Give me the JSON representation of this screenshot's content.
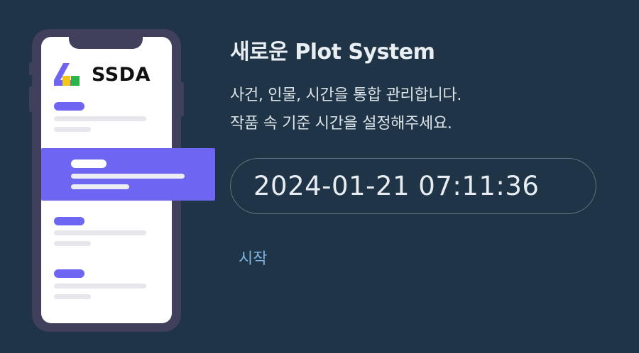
{
  "brand": {
    "logo_text": "SSDA",
    "logo_icon": "ssda-logo-icon",
    "logo_colors": [
      "#6e66f2",
      "#f5c518",
      "#2db34a"
    ]
  },
  "colors": {
    "background": "#1f3446",
    "phone_frame": "#40405c",
    "accent": "#6e66f2",
    "link": "#7fb3e0"
  },
  "info": {
    "title": "새로운 Plot System",
    "description_line1": "사건, 인물, 시간을 통합 관리합니다.",
    "description_line2": "작품 속 기준 시간을 설정해주세요."
  },
  "time_input": {
    "value": "2024-01-21 07:11:36"
  },
  "actions": {
    "start_label": "시작"
  }
}
